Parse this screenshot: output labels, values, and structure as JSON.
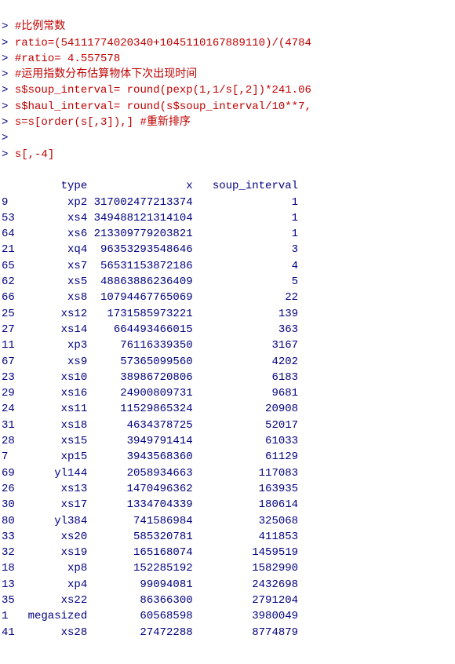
{
  "lines": [
    {
      "prompt": "> ",
      "text": "#比例常数"
    },
    {
      "prompt": "> ",
      "text": "ratio=(54111774020340+1045110167889110)/(4784"
    },
    {
      "prompt": "> ",
      "text": "#ratio= 4.557578"
    },
    {
      "prompt": "> ",
      "text": "#运用指数分布估算物体下次出现时间"
    },
    {
      "prompt": "> ",
      "text": "s$soup_interval= round(pexp(1,1/s[,2])*241.06"
    },
    {
      "prompt": "> ",
      "text": "s$haul_interval= round(s$soup_interval/10**7,"
    },
    {
      "prompt": "> ",
      "text": "s=s[order(s[,3]),] #重新排序"
    },
    {
      "prompt": "> ",
      "text": ""
    },
    {
      "prompt": "> ",
      "text": "s[,-4]"
    }
  ],
  "header": {
    "rowlabel_pad": "  ",
    "type_header": "      type",
    "x_header": "               x",
    "soup_header": "   soup_interval"
  },
  "rows": [
    {
      "rn": "9 ",
      "type": "       xp2",
      "x": " 317002477213374",
      "soup": "               1"
    },
    {
      "rn": "53",
      "type": "       xs4",
      "x": " 349488121314104",
      "soup": "               1"
    },
    {
      "rn": "64",
      "type": "       xs6",
      "x": " 213309779203821",
      "soup": "               1"
    },
    {
      "rn": "21",
      "type": "       xq4",
      "x": "  96353293548646",
      "soup": "               3"
    },
    {
      "rn": "65",
      "type": "       xs7",
      "x": "  56531153872186",
      "soup": "               4"
    },
    {
      "rn": "62",
      "type": "       xs5",
      "x": "  48863886236409",
      "soup": "               5"
    },
    {
      "rn": "66",
      "type": "       xs8",
      "x": "  10794467765069",
      "soup": "              22"
    },
    {
      "rn": "25",
      "type": "      xs12",
      "x": "   1731585973221",
      "soup": "             139"
    },
    {
      "rn": "27",
      "type": "      xs14",
      "x": "    664493466015",
      "soup": "             363"
    },
    {
      "rn": "11",
      "type": "       xp3",
      "x": "     76116339350",
      "soup": "            3167"
    },
    {
      "rn": "67",
      "type": "       xs9",
      "x": "     57365099560",
      "soup": "            4202"
    },
    {
      "rn": "23",
      "type": "      xs10",
      "x": "     38986720806",
      "soup": "            6183"
    },
    {
      "rn": "29",
      "type": "      xs16",
      "x": "     24900809731",
      "soup": "            9681"
    },
    {
      "rn": "24",
      "type": "      xs11",
      "x": "     11529865324",
      "soup": "           20908"
    },
    {
      "rn": "31",
      "type": "      xs18",
      "x": "      4634378725",
      "soup": "           52017"
    },
    {
      "rn": "28",
      "type": "      xs15",
      "x": "      3949791414",
      "soup": "           61033"
    },
    {
      "rn": "7 ",
      "type": "      xp15",
      "x": "      3943568360",
      "soup": "           61129"
    },
    {
      "rn": "69",
      "type": "     yl144",
      "x": "      2058934663",
      "soup": "          117083"
    },
    {
      "rn": "26",
      "type": "      xs13",
      "x": "      1470496362",
      "soup": "          163935"
    },
    {
      "rn": "30",
      "type": "      xs17",
      "x": "      1334704339",
      "soup": "          180614"
    },
    {
      "rn": "80",
      "type": "     yl384",
      "x": "       741586984",
      "soup": "          325068"
    },
    {
      "rn": "33",
      "type": "      xs20",
      "x": "       585320781",
      "soup": "          411853"
    },
    {
      "rn": "32",
      "type": "      xs19",
      "x": "       165168074",
      "soup": "         1459519"
    },
    {
      "rn": "18",
      "type": "       xp8",
      "x": "       152285192",
      "soup": "         1582990"
    },
    {
      "rn": "13",
      "type": "       xp4",
      "x": "        99094081",
      "soup": "         2432698"
    },
    {
      "rn": "35",
      "type": "      xs22",
      "x": "        86366300",
      "soup": "         2791204"
    },
    {
      "rn": "1 ",
      "type": " megasized",
      "x": "        60568598",
      "soup": "         3980049"
    },
    {
      "rn": "41",
      "type": "      xs28",
      "x": "        27472288",
      "soup": "         8774879"
    }
  ]
}
